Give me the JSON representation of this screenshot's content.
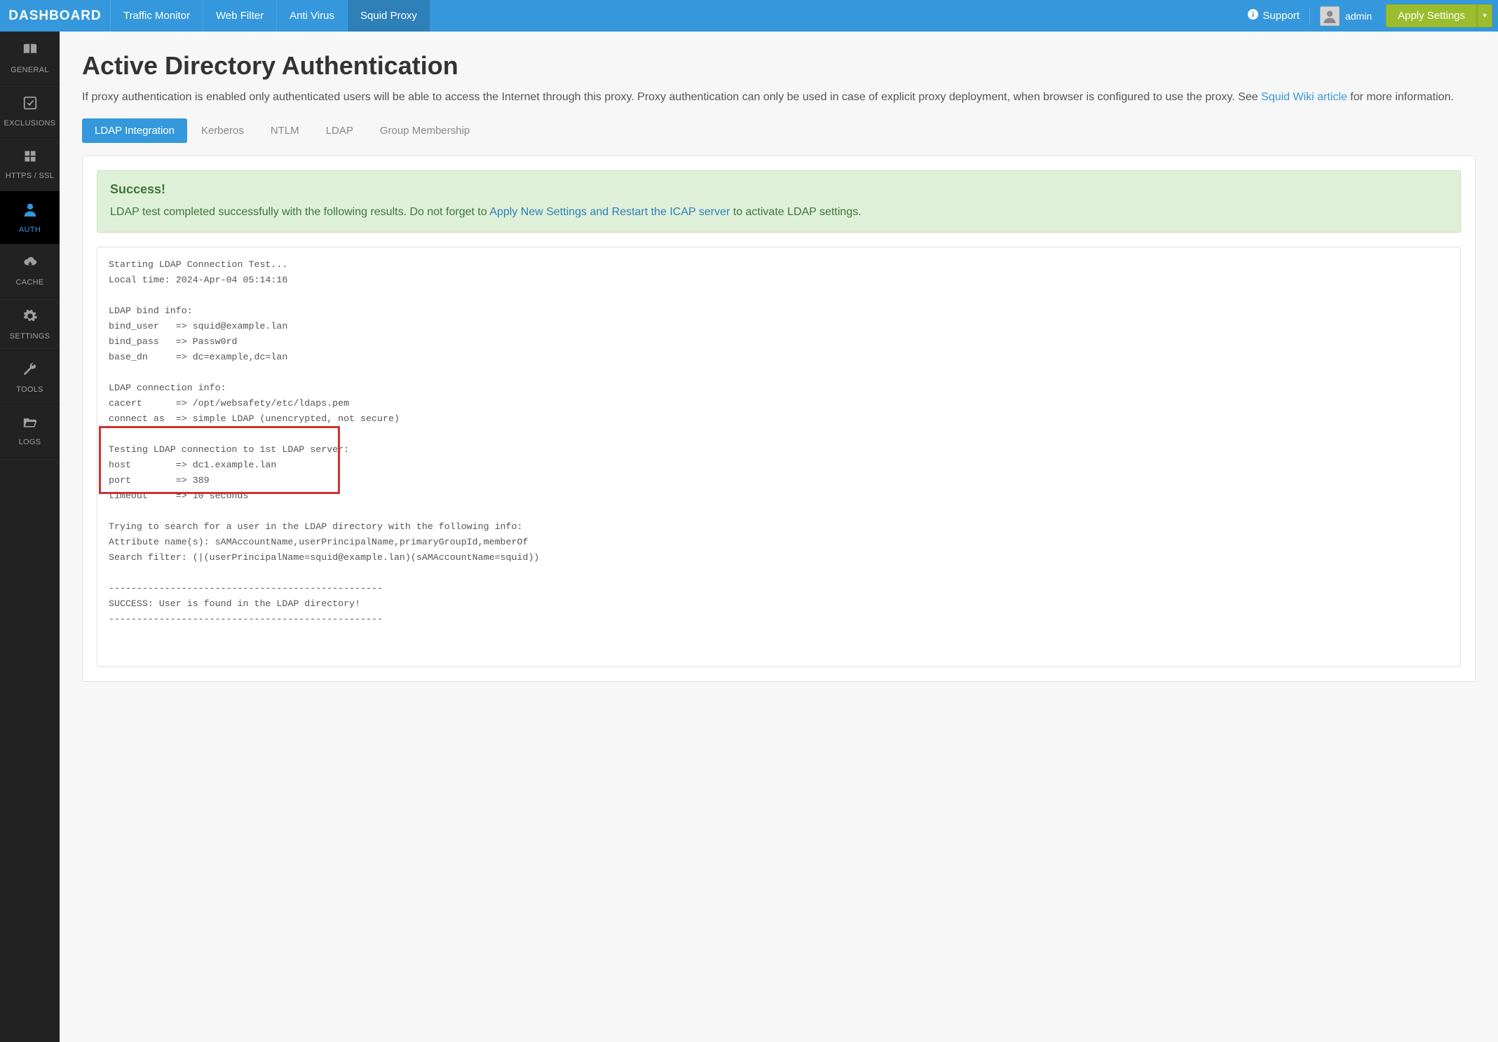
{
  "brand": "DASHBOARD",
  "topnav": {
    "traffic": "Traffic Monitor",
    "webfilter": "Web Filter",
    "antivirus": "Anti Virus",
    "squid": "Squid Proxy"
  },
  "topright": {
    "support": "Support",
    "username": "admin",
    "apply": "Apply Settings"
  },
  "sidebar": {
    "general": "GENERAL",
    "exclusions": "EXCLUSIONS",
    "https": "HTTPS / SSL",
    "auth": "AUTH",
    "cache": "CACHE",
    "settings": "SETTINGS",
    "tools": "TOOLS",
    "logs": "LOGS"
  },
  "page": {
    "title": "Active Directory Authentication",
    "lead_pre": "If proxy authentication is enabled only authenticated users will be able to access the Internet through this proxy. Proxy authentication can only be used in case of explicit proxy deployment, when browser is configured to use the proxy. See ",
    "lead_link": "Squid Wiki article",
    "lead_post": " for more information."
  },
  "tabs": {
    "ldap_integration": "LDAP Integration",
    "kerberos": "Kerberos",
    "ntlm": "NTLM",
    "ldap": "LDAP",
    "group_membership": "Group Membership"
  },
  "alert": {
    "title": "Success!",
    "pre": "LDAP test completed successfully with the following results. Do not forget to ",
    "link": "Apply New Settings and Restart the ICAP server",
    "post": " to activate LDAP settings."
  },
  "log": {
    "line1": "Starting LDAP Connection Test...",
    "line2": "Local time: 2024-Apr-04 05:14:16",
    "blank": "",
    "line3": "LDAP bind info:",
    "line4": "bind_user   => squid@example.lan",
    "line5": "bind_pass   => Passw0rd",
    "line6": "base_dn     => dc=example,dc=lan",
    "line7": "LDAP connection info:",
    "line8": "cacert      => /opt/websafety/etc/ldaps.pem",
    "line9": "connect as  => simple LDAP (unencrypted, not secure)",
    "line10": "Testing LDAP connection to 1st LDAP server:",
    "line11": "host        => dc1.example.lan",
    "line12": "port        => 389",
    "line13": "timeout     => 10 seconds",
    "line14": "Trying to search for a user in the LDAP directory with the following info:",
    "line15": "Attribute name(s): sAMAccountName,userPrincipalName,primaryGroupId,memberOf",
    "line16": "Search filter: (|(userPrincipalName=squid@example.lan)(sAMAccountName=squid))",
    "sep": "-------------------------------------------------",
    "line17": "SUCCESS: User is found in the LDAP directory!"
  }
}
